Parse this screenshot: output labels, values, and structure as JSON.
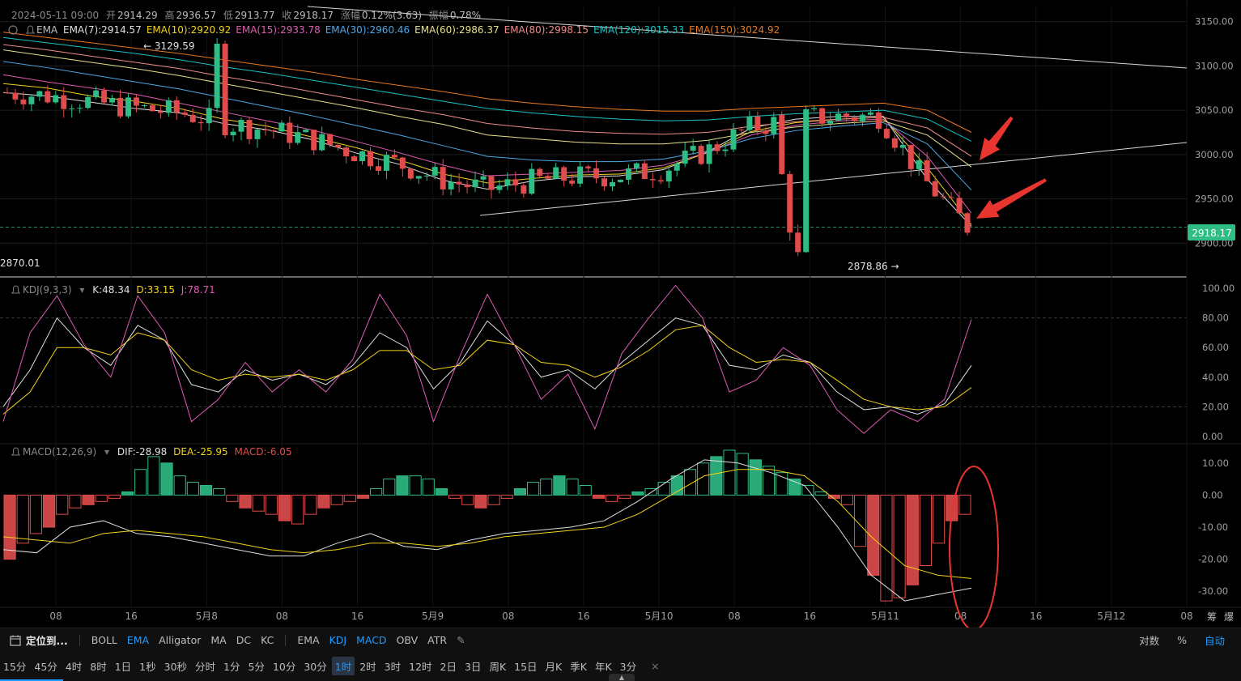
{
  "header": {
    "time": "2024-05-11 09:00",
    "open_label": "开",
    "open": "2914.29",
    "high_label": "高",
    "high": "2936.57",
    "low_label": "低",
    "low": "2913.77",
    "close_label": "收",
    "close": "2918.17",
    "change_label": "涨幅",
    "change": "0.12%(3.63)",
    "amp_label": "振幅",
    "amp": "0.78%"
  },
  "ema_legend": [
    {
      "text": "EMA(7):2914.57",
      "color": "#e0e0e0"
    },
    {
      "text": "EMA(10):2920.92",
      "color": "#f2d21b"
    },
    {
      "text": "EMA(15):2933.78",
      "color": "#e05bb4"
    },
    {
      "text": "EMA(30):2960.46",
      "color": "#4aa8e8"
    },
    {
      "text": "EMA(60):2986.37",
      "color": "#e6e08a"
    },
    {
      "text": "EMA(80):2998.15",
      "color": "#f08a8a"
    },
    {
      "text": "EMA(120):3015.33",
      "color": "#19c3c3"
    },
    {
      "text": "EMA(150):3024.92",
      "color": "#e8781e"
    }
  ],
  "ema_label": "EMA",
  "kdj_legend": {
    "name": "KDJ(9,3,3)",
    "k": "K:48.34",
    "d": "D:33.15",
    "j": "J:78.71"
  },
  "macd_legend": {
    "name": "MACD(12,26,9)",
    "dif": "DIF:-28.98",
    "dea": "DEA:-25.95",
    "macd": "MACD:-6.05"
  },
  "price_annotations": {
    "high": "← 3129.59",
    "low": "2878.86 →",
    "left": "2870.01",
    "current": "2918.17"
  },
  "colors": {
    "up": "#2ebd85",
    "down": "#e04c4c",
    "bg": "#000000",
    "grid": "#1c1c1c",
    "accent": "#1e9bff"
  },
  "chart_data": [
    {
      "type": "candlestick",
      "title": "",
      "x_ticks": [
        "08",
        "16",
        "5月8",
        "08",
        "16",
        "5月9",
        "08",
        "16",
        "5月10",
        "08",
        "16",
        "5月11",
        "08",
        "16",
        "5月12",
        "08"
      ],
      "y_ticks": [
        3150,
        3100,
        3050,
        3000,
        2950,
        2900
      ],
      "ylim": [
        2862,
        3167
      ],
      "grid": true,
      "last_price": 2918.17,
      "series": [
        {
          "name": "EMA(7)",
          "values": [
            3070,
            3066,
            3059,
            3052,
            3047,
            3035,
            3028,
            3017,
            3002,
            2989,
            2971,
            2961,
            2970,
            2975,
            2976,
            2983,
            3003,
            3030,
            3040,
            3043,
            3043,
            2972,
            2919
          ]
        },
        {
          "name": "EMA(10)",
          "values": [
            3080,
            3075,
            3066,
            3060,
            3052,
            3040,
            3032,
            3020,
            3008,
            2994,
            2978,
            2968,
            2973,
            2977,
            2978,
            2985,
            3002,
            3026,
            3036,
            3040,
            3042,
            2985,
            2921
          ]
        },
        {
          "name": "EMA(15)",
          "values": [
            3090,
            3082,
            3075,
            3068,
            3058,
            3048,
            3038,
            3028,
            3015,
            3002,
            2988,
            2976,
            2978,
            2980,
            2982,
            2988,
            3002,
            3022,
            3033,
            3038,
            3040,
            2998,
            2934
          ]
        },
        {
          "name": "EMA(30)",
          "values": [
            3105,
            3098,
            3090,
            3082,
            3074,
            3064,
            3054,
            3044,
            3033,
            3022,
            3010,
            2998,
            2994,
            2992,
            2992,
            2995,
            3004,
            3018,
            3027,
            3032,
            3036,
            3012,
            2960
          ]
        },
        {
          "name": "EMA(60)",
          "values": [
            3118,
            3111,
            3104,
            3097,
            3089,
            3080,
            3071,
            3062,
            3053,
            3043,
            3034,
            3022,
            3018,
            3014,
            3012,
            3012,
            3016,
            3025,
            3031,
            3035,
            3038,
            3022,
            2986
          ]
        },
        {
          "name": "EMA(80)",
          "values": [
            3124,
            3118,
            3111,
            3104,
            3097,
            3088,
            3080,
            3071,
            3062,
            3053,
            3045,
            3035,
            3030,
            3026,
            3024,
            3023,
            3025,
            3032,
            3037,
            3040,
            3042,
            3030,
            2998
          ]
        },
        {
          "name": "EMA(120)",
          "values": [
            3132,
            3126,
            3120,
            3114,
            3107,
            3099,
            3092,
            3084,
            3076,
            3068,
            3060,
            3052,
            3047,
            3043,
            3040,
            3038,
            3039,
            3043,
            3046,
            3048,
            3050,
            3040,
            3015
          ]
        },
        {
          "name": "EMA(150)",
          "values": [
            3138,
            3132,
            3126,
            3120,
            3114,
            3107,
            3100,
            3093,
            3085,
            3078,
            3071,
            3063,
            3058,
            3054,
            3051,
            3049,
            3049,
            3052,
            3054,
            3056,
            3058,
            3050,
            3025
          ]
        }
      ]
    },
    {
      "type": "line",
      "title": "",
      "y_ticks": [
        100,
        80,
        60,
        40,
        20,
        0
      ],
      "ylim": [
        -5,
        105
      ],
      "series": [
        {
          "name": "K",
          "values": [
            20,
            45,
            80,
            60,
            48,
            75,
            65,
            35,
            30,
            45,
            38,
            42,
            35,
            48,
            70,
            60,
            32,
            50,
            78,
            62,
            40,
            45,
            32,
            50,
            65,
            80,
            75,
            48,
            45,
            55,
            50,
            30,
            18,
            20,
            15,
            22,
            48
          ]
        },
        {
          "name": "D",
          "values": [
            15,
            30,
            60,
            60,
            55,
            70,
            65,
            45,
            38,
            42,
            40,
            42,
            38,
            45,
            58,
            58,
            45,
            48,
            65,
            62,
            50,
            48,
            40,
            47,
            58,
            72,
            75,
            60,
            50,
            52,
            50,
            38,
            25,
            20,
            18,
            20,
            33
          ]
        },
        {
          "name": "J",
          "values": [
            10,
            70,
            95,
            62,
            40,
            95,
            70,
            10,
            25,
            50,
            30,
            45,
            30,
            52,
            96,
            68,
            10,
            55,
            96,
            62,
            25,
            42,
            5,
            56,
            80,
            102,
            80,
            30,
            38,
            60,
            48,
            18,
            2,
            18,
            10,
            25,
            79
          ]
        }
      ]
    },
    {
      "type": "bar",
      "title": "",
      "y_ticks": [
        10,
        0,
        -10,
        -20,
        -30
      ],
      "ylim": [
        -35,
        15
      ],
      "histogram": [
        -20,
        -15,
        -12,
        -10,
        -6,
        -4,
        -3,
        -2,
        -1,
        1,
        8,
        12,
        10,
        6,
        4,
        3,
        2,
        -2,
        -4,
        -5,
        -6,
        -8,
        -9,
        -6,
        -4,
        -3,
        -2,
        -1,
        2,
        5,
        6,
        6,
        5,
        2,
        -1,
        -3,
        -4,
        -3,
        -1,
        2,
        4,
        5,
        6,
        5,
        3,
        -1,
        -2,
        -1,
        1,
        2,
        4,
        6,
        8,
        10,
        12,
        14,
        13,
        11,
        9,
        7,
        5,
        3,
        1,
        -1,
        -3,
        -16,
        -25,
        -33,
        -32,
        -28,
        -22,
        -15,
        -8,
        -6
      ],
      "series": [
        {
          "name": "DIF",
          "values": [
            -17,
            -18,
            -10,
            -8,
            -12,
            -13,
            -15,
            -17,
            -19,
            -19,
            -15,
            -12,
            -16,
            -17,
            -14,
            -12,
            -11,
            -10,
            -8,
            -2,
            5,
            11,
            10,
            7,
            3,
            -10,
            -25,
            -33,
            -31,
            -29
          ]
        },
        {
          "name": "DEA",
          "values": [
            -13,
            -14,
            -15,
            -12,
            -11,
            -12,
            -13,
            -15,
            -17,
            -18,
            -17,
            -15,
            -15,
            -16,
            -15,
            -13,
            -12,
            -11,
            -10,
            -6,
            0,
            6,
            8,
            8,
            6,
            -2,
            -13,
            -22,
            -25,
            -26
          ]
        }
      ]
    }
  ],
  "x_axis_right": {
    "label": "筹",
    "label2": "爆"
  },
  "toolbar1": {
    "locate": "定位到...",
    "main_indicators": [
      "BOLL",
      "EMA",
      "Alligator",
      "MA",
      "DC",
      "KC"
    ],
    "main_active": "EMA",
    "sub_indicators": [
      "EMA",
      "KDJ",
      "MACD",
      "OBV",
      "ATR"
    ],
    "sub_active": [
      "KDJ",
      "MACD"
    ],
    "right": [
      "对数",
      "%",
      "自动"
    ],
    "right_active": "自动"
  },
  "toolbar2": {
    "timeframes": [
      "15分",
      "45分",
      "4时",
      "8时",
      "1日",
      "1秒",
      "30秒",
      "分时",
      "1分",
      "5分",
      "10分",
      "30分",
      "1时",
      "2时",
      "3时",
      "12时",
      "2日",
      "3日",
      "周K",
      "15日",
      "月K",
      "季K",
      "年K",
      "3分"
    ],
    "active": "1时",
    "close": "×"
  }
}
